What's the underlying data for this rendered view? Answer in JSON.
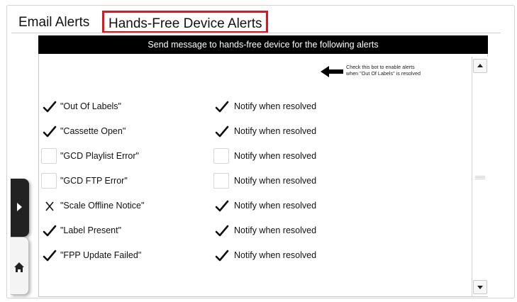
{
  "tabs": {
    "email": "Email Alerts",
    "handsfree": "Hands-Free Device Alerts"
  },
  "header": {
    "text": "Send message to hands-free device for the following alerts"
  },
  "hint": {
    "line1": "Check this bot to enable alerts",
    "line2": "when \"Out Of Labels\" is resolved"
  },
  "accent_color": "#e0161e",
  "alerts": [
    {
      "label": "\"Out Of Labels\"",
      "alert_state": "checked",
      "notify_label": "Notify when resolved",
      "notify_state": "checked"
    },
    {
      "label": "\"Cassette Open\"",
      "alert_state": "checked",
      "notify_label": "Notify when resolved",
      "notify_state": "checked"
    },
    {
      "label": "\"GCD Playlist Error\"",
      "alert_state": "unchecked",
      "notify_label": "Notify when resolved",
      "notify_state": "unchecked"
    },
    {
      "label": "\"GCD FTP Error\"",
      "alert_state": "unchecked",
      "notify_label": "Notify when resolved",
      "notify_state": "unchecked"
    },
    {
      "label": "\"Scale Offline Notice\"",
      "alert_state": "crossed",
      "notify_label": "Notify when resolved",
      "notify_state": "checked"
    },
    {
      "label": "\"Label Present\"",
      "alert_state": "checked",
      "notify_label": "Notify when resolved",
      "notify_state": "checked"
    },
    {
      "label": "\"FPP Update Failed\"",
      "alert_state": "checked",
      "notify_label": "Notify when resolved",
      "notify_state": "checked"
    }
  ]
}
